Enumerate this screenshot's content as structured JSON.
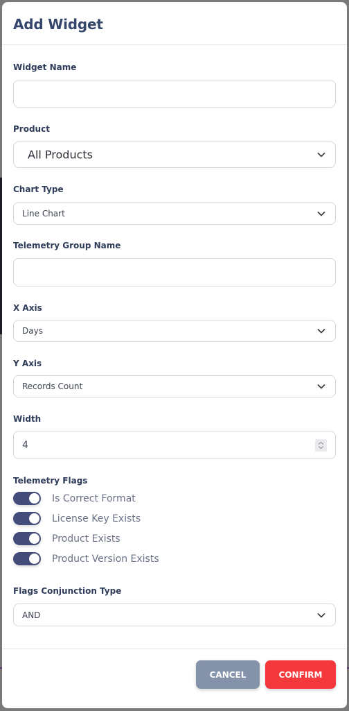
{
  "modal": {
    "title": "Add Widget"
  },
  "fields": {
    "widget_name": {
      "label": "Widget Name",
      "value": "",
      "placeholder": ""
    },
    "product": {
      "label": "Product",
      "selected": "All Products"
    },
    "chart_type": {
      "label": "Chart Type",
      "selected": "Line Chart"
    },
    "telemetry_group_name": {
      "label": "Telemetry Group Name",
      "value": "",
      "placeholder": ""
    },
    "x_axis": {
      "label": "X Axis",
      "selected": "Days"
    },
    "y_axis": {
      "label": "Y Axis",
      "selected": "Records Count"
    },
    "width": {
      "label": "Width",
      "value": "4"
    },
    "telemetry_flags": {
      "label": "Telemetry Flags",
      "items": [
        {
          "label": "Is Correct Format",
          "on": true
        },
        {
          "label": "License Key Exists",
          "on": true
        },
        {
          "label": "Product Exists",
          "on": true
        },
        {
          "label": "Product Version Exists",
          "on": true
        }
      ]
    },
    "flags_conjunction_type": {
      "label": "Flags Conjunction Type",
      "selected": "AND"
    }
  },
  "footer": {
    "cancel_label": "CANCEL",
    "confirm_label": "CONFIRM"
  },
  "colors": {
    "title": "#34466a",
    "toggle_on": "#444c7a",
    "cancel": "#8492aa",
    "confirm": "#f5383b"
  }
}
